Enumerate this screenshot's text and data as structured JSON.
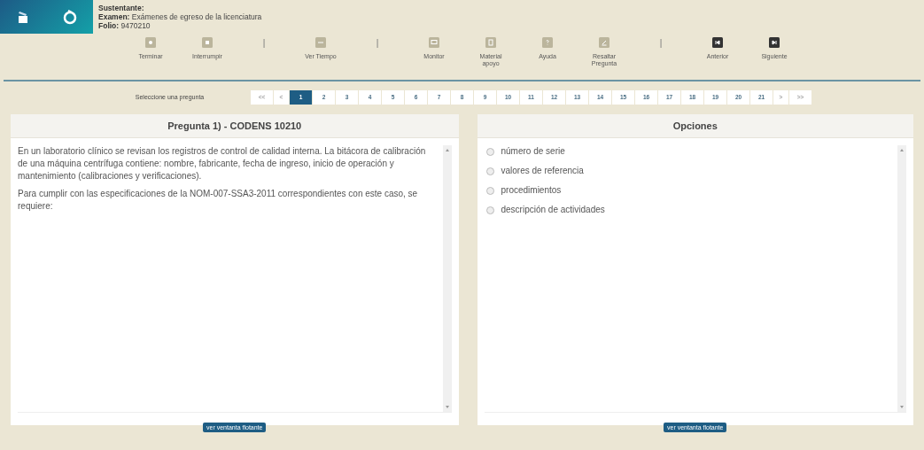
{
  "candidate": {
    "fields": [
      {
        "label": "Sustentante:"
      },
      {
        "label": "Examen:",
        "value": "Exámenes de egreso de la licenciatura"
      },
      {
        "label": "Folio:",
        "value": "9470210"
      }
    ]
  },
  "toolbar": [
    {
      "kind": "tool",
      "label": "Terminar",
      "disabled": true
    },
    {
      "kind": "tool",
      "label": "Interrumpir",
      "disabled": true
    },
    {
      "kind": "separator",
      "label": "|"
    },
    {
      "kind": "tool",
      "label": "Ver Tiempo",
      "disabled": true
    },
    {
      "kind": "separator",
      "label": "|"
    },
    {
      "kind": "tool",
      "label": "Monitor",
      "disabled": true
    },
    {
      "kind": "tool",
      "label": "Material apoyo",
      "disabled": true
    },
    {
      "kind": "tool",
      "label": "Ayuda",
      "disabled": true
    },
    {
      "kind": "tool",
      "label": "Resaltar Pregunta",
      "disabled": true
    },
    {
      "kind": "separator",
      "label": "|"
    },
    {
      "kind": "tool",
      "label": "Anterior",
      "disabled": false
    },
    {
      "kind": "tool",
      "label": "Siguiente",
      "disabled": false
    }
  ],
  "pager": {
    "label": "Seleccione una pregunta",
    "first": "<<",
    "prev": "<",
    "next": ">",
    "last": ">>",
    "pages": [
      {
        "label": "1",
        "selected": true
      },
      {
        "label": "2",
        "selected": false
      },
      {
        "label": "3",
        "selected": false
      },
      {
        "label": "4",
        "selected": false
      },
      {
        "label": "5",
        "selected": false
      },
      {
        "label": "6",
        "selected": false
      },
      {
        "label": "7",
        "selected": false
      },
      {
        "label": "8",
        "selected": false
      },
      {
        "label": "9",
        "selected": false
      },
      {
        "label": "10",
        "selected": false
      },
      {
        "label": "11",
        "selected": false
      },
      {
        "label": "12",
        "selected": false
      },
      {
        "label": "13",
        "selected": false
      },
      {
        "label": "14",
        "selected": false
      },
      {
        "label": "15",
        "selected": false
      },
      {
        "label": "16",
        "selected": false
      },
      {
        "label": "17",
        "selected": false
      },
      {
        "label": "18",
        "selected": false
      },
      {
        "label": "19",
        "selected": false
      },
      {
        "label": "20",
        "selected": false
      },
      {
        "label": "21",
        "selected": false
      }
    ]
  },
  "question": {
    "title": "Pregunta 1) - CODENS 10210",
    "paragraphs": [
      "En un laboratorio clínico se revisan los registros de control de calidad interna. La bitácora de calibración de una máquina centrífuga contiene: nombre, fabricante, fecha de ingreso, inicio de operación y mantenimiento (calibraciones y verificaciones).",
      "Para cumplir con las especificaciones de la NOM-007-SSA3-2011 correspondientes con este caso, se requiere:"
    ],
    "button": "ver ventanta flotante"
  },
  "options": {
    "title": "Opciones",
    "items": [
      {
        "label": "número de serie",
        "selected": false
      },
      {
        "label": "valores de referencia",
        "selected": false
      },
      {
        "label": "procedimientos",
        "selected": false
      },
      {
        "label": "descripción de actividades",
        "selected": false
      }
    ],
    "button": "ver ventanta flotante"
  }
}
